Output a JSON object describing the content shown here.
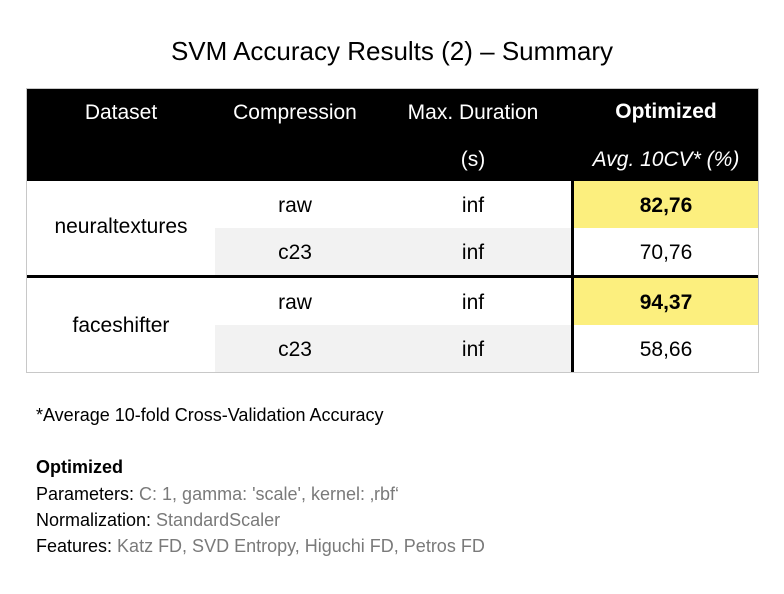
{
  "title": "SVM Accuracy Results (2) – Summary",
  "table": {
    "headers": {
      "dataset": "Dataset",
      "compression": "Compression",
      "max_duration": "Max. Duration",
      "max_duration_unit": "(s)",
      "optimized": "Optimized",
      "optimized_sub": "Avg. 10CV* (%)"
    },
    "groups": [
      {
        "dataset": "neuraltextures",
        "rows": [
          {
            "compression": "raw",
            "duration": "inf",
            "accuracy": "82,76",
            "highlight": true
          },
          {
            "compression": "c23",
            "duration": "inf",
            "accuracy": "70,76",
            "highlight": false
          }
        ]
      },
      {
        "dataset": "faceshifter",
        "rows": [
          {
            "compression": "raw",
            "duration": "inf",
            "accuracy": "94,37",
            "highlight": true
          },
          {
            "compression": "c23",
            "duration": "inf",
            "accuracy": "58,66",
            "highlight": false
          }
        ]
      }
    ]
  },
  "footnote": "*Average 10-fold Cross-Validation Accuracy",
  "optimized": {
    "heading": "Optimized",
    "lines": [
      {
        "label": "Parameters: ",
        "value": "C: 1, gamma: 'scale', kernel: ‚rbf‘"
      },
      {
        "label": "Normalization: ",
        "value": "StandardScaler"
      },
      {
        "label": "Features: ",
        "value": "Katz FD, SVD Entropy, Higuchi FD, Petros FD"
      }
    ]
  },
  "colors": {
    "header_bg": "#000000",
    "highlight": "#fcef7e",
    "alt_row": "#f2f2f2"
  }
}
